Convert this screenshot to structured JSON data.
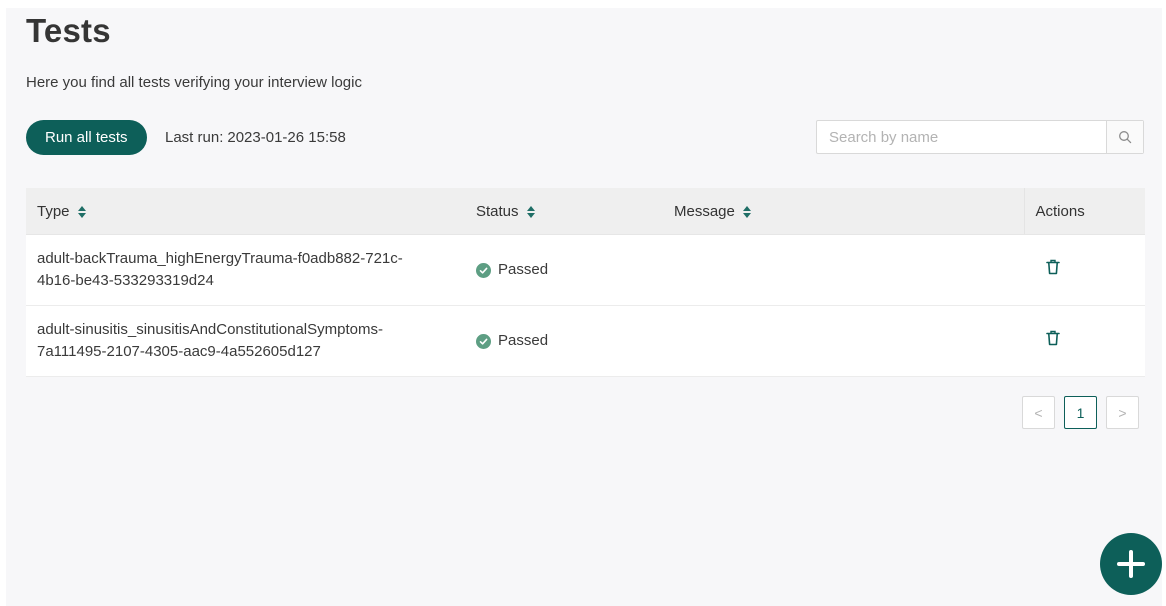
{
  "page": {
    "title": "Tests",
    "subtitle": "Here you find all tests verifying your interview logic"
  },
  "toolbar": {
    "run_all_label": "Run all tests",
    "last_run_label": "Last run:",
    "last_run_value": "2023-01-26 15:58"
  },
  "search": {
    "placeholder": "Search by name",
    "value": "",
    "icon": "search-icon"
  },
  "table": {
    "columns": [
      "Type",
      "Status",
      "Message",
      "Actions"
    ],
    "rows": [
      {
        "type_line1": "adult-backTrauma_highEnergyTrauma-f0adb882-721c-",
        "type_line2": "4b16-be43-533293319d24",
        "status": "Passed",
        "message": "",
        "action_icon": "trash-icon"
      },
      {
        "type_line1": "adult-sinusitis_sinusitisAndConstitutionalSymptoms-",
        "type_line2": "7a111495-2107-4305-aac9-4a552605d127",
        "status": "Passed",
        "message": "",
        "action_icon": "trash-icon"
      }
    ]
  },
  "pagination": {
    "prev": "<",
    "current": "1",
    "next": ">"
  },
  "colors": {
    "accent": "#0d5f59",
    "passed": "#5d9e83",
    "background": "#f7f7f9"
  },
  "fab": {
    "icon": "plus-icon"
  }
}
